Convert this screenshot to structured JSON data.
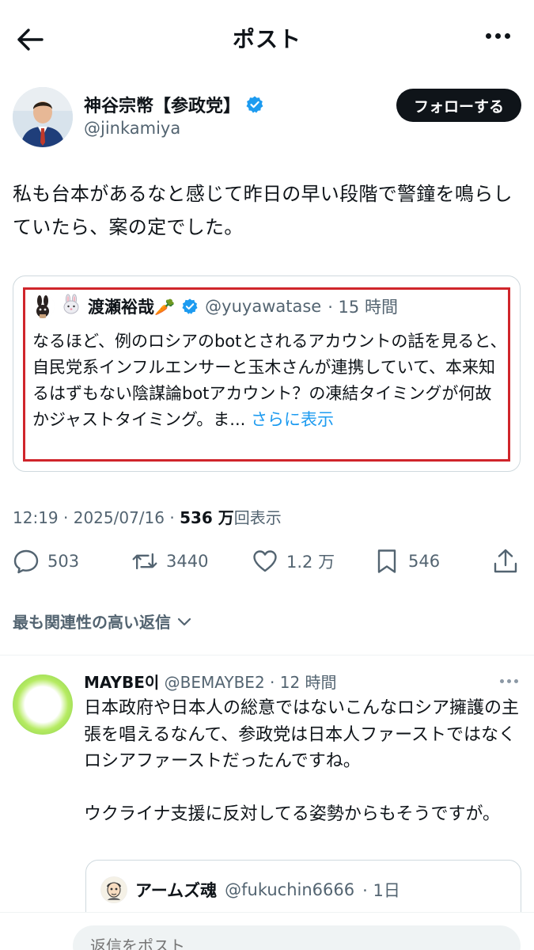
{
  "header": {
    "title": "ポスト"
  },
  "author": {
    "name": "神谷宗幣【参政党】",
    "handle": "@jinkamiya",
    "follow_label": "フォローする"
  },
  "post": {
    "text": "私も台本があるなと感じて昨日の早い段階で警鐘を鳴らしていたら、案の定でした。"
  },
  "quoted_post": {
    "name": "渡瀬裕哉🥕",
    "handle": "@yuyawatase",
    "time": "· 15 時間",
    "text": "なるほど、例のロシアのbotとされるアカウントの話を見ると、\n自民党系インフルエンサーと玉木さんが連携していて、本来知るはずもない陰謀論botアカウント？の凍結タイミングが何故かジャストタイミング。ま...",
    "show_more": "さらに表示"
  },
  "meta": {
    "time": "12:19",
    "date": "2025/07/16",
    "views_count": "536 万",
    "views_label": "回表示"
  },
  "actions": {
    "replies": "503",
    "reposts": "3440",
    "likes": "1.2 万",
    "bookmarks": "546"
  },
  "sort": {
    "label": "最も関連性の高い返信"
  },
  "reply": {
    "name": "MAYBE이",
    "handle": "@BEMAYBE2",
    "time": "· 12 時間",
    "text": "日本政府や日本人の総意ではないこんなロシア擁護の主張を唱えるなんて、参政党は日本人ファーストではなくロシアファーストだったんですね。\n\nウクライナ支援に反対してる姿勢からもそうですが。"
  },
  "nested_quote": {
    "name": "アームズ魂",
    "handle": "@fukuchin6666",
    "time": "· 1日"
  },
  "composer": {
    "placeholder": "返信をポスト"
  },
  "colors": {
    "text": "#0f1419",
    "secondary": "#536471",
    "accent": "#1d9bf0",
    "highlight_border": "#d0252b"
  }
}
